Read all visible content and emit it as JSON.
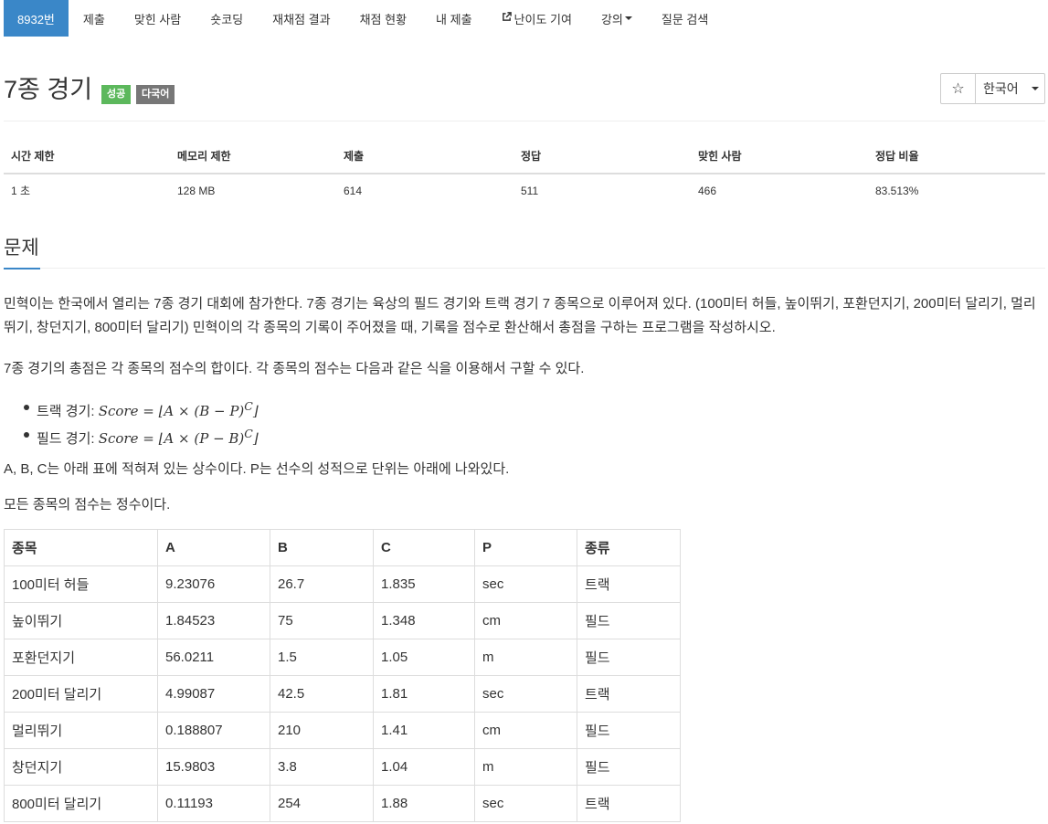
{
  "nav": {
    "items": [
      {
        "label": "8932번",
        "active": true
      },
      {
        "label": "제출"
      },
      {
        "label": "맞힌 사람"
      },
      {
        "label": "숏코딩"
      },
      {
        "label": "재채점 결과"
      },
      {
        "label": "채점 현황"
      },
      {
        "label": "내 제출"
      },
      {
        "label": "난이도 기여",
        "icon": "external-link-icon"
      },
      {
        "label": "강의",
        "icon": "caret-down-icon"
      },
      {
        "label": "질문 검색"
      }
    ]
  },
  "header": {
    "title": "7종 경기",
    "badge_success": "성공",
    "badge_lang": "다국어",
    "star_icon": "☆",
    "language_select": "한국어"
  },
  "info_table": {
    "headers": [
      "시간 제한",
      "메모리 제한",
      "제출",
      "정답",
      "맞힌 사람",
      "정답 비율"
    ],
    "values": [
      "1 초",
      "128 MB",
      "614",
      "511",
      "466",
      "83.513%"
    ]
  },
  "problem": {
    "section_title": "문제",
    "para1": "민혁이는 한국에서 열리는 7종 경기 대회에 참가한다. 7종 경기는 육상의 필드 경기와 트랙 경기 7 종목으로 이루어져 있다. (100미터 허들, 높이뛰기, 포환던지기, 200미터 달리기, 멀리뛰기, 창던지기, 800미터 달리기) 민혁이의 각 종목의 기록이 주어졌을 때, 기록을 점수로 환산해서 총점을 구하는 프로그램을 작성하시오.",
    "para2": "7종 경기의 총점은 각 종목의 점수의 합이다. 각 종목의 점수는 다음과 같은 식을 이용해서 구할 수 있다.",
    "bullets": [
      {
        "label": "트랙 경기: ",
        "formula": "Score = ⌊A × (B − P)",
        "exp": "C",
        "close": "⌋"
      },
      {
        "label": "필드 경기: ",
        "formula": "Score = ⌊A × (P − B)",
        "exp": "C",
        "close": "⌋"
      }
    ],
    "para3": "A, B, C는 아래 표에 적혀져 있는 상수이다. P는 선수의 성적으로 단위는 아래에 나와있다.",
    "para4": "모든 종목의 점수는 정수이다."
  },
  "events_table": {
    "headers": [
      "종목",
      "A",
      "B",
      "C",
      "P",
      "종류"
    ],
    "rows": [
      [
        "100미터 허들",
        "9.23076",
        "26.7",
        "1.835",
        "sec",
        "트랙"
      ],
      [
        "높이뛰기",
        "1.84523",
        "75",
        "1.348",
        "cm",
        "필드"
      ],
      [
        "포환던지기",
        "56.0211",
        "1.5",
        "1.05",
        "m",
        "필드"
      ],
      [
        "200미터 달리기",
        "4.99087",
        "42.5",
        "1.81",
        "sec",
        "트랙"
      ],
      [
        "멀리뛰기",
        "0.188807",
        "210",
        "1.41",
        "cm",
        "필드"
      ],
      [
        "창던지기",
        "15.9803",
        "3.8",
        "1.04",
        "m",
        "필드"
      ],
      [
        "800미터 달리기",
        "0.11193",
        "254",
        "1.88",
        "sec",
        "트랙"
      ]
    ]
  }
}
